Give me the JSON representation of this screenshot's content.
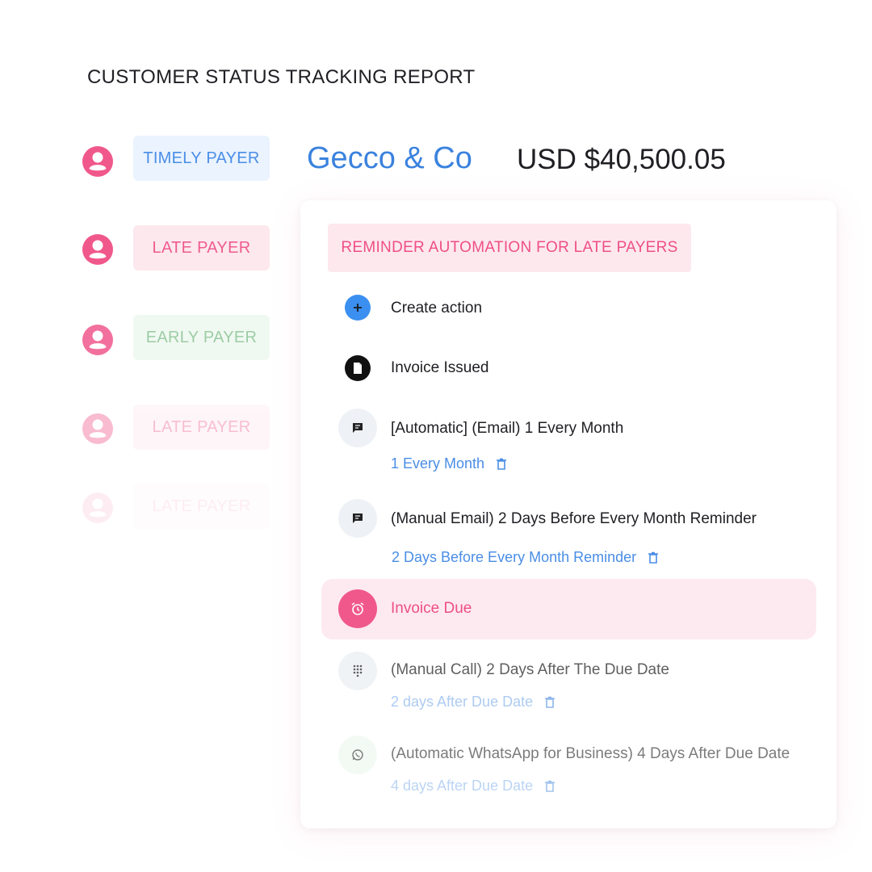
{
  "report_title": "CUSTOMER STATUS TRACKING REPORT",
  "customers": [
    {
      "status": "TIMELY PAYER",
      "variant": "blue",
      "opacity": 1
    },
    {
      "status": "LATE PAYER",
      "variant": "pink",
      "opacity": 1
    },
    {
      "status": "EARLY PAYER",
      "variant": "green",
      "opacity": 1
    },
    {
      "status": "LATE PAYER",
      "variant": "pink",
      "opacity": 0.45
    },
    {
      "status": "LATE PAYER",
      "variant": "pink",
      "opacity": 0.12
    }
  ],
  "company_name": "Gecco & Co",
  "amount": "USD $40,500.05",
  "automation": {
    "header": "REMINDER AUTOMATION FOR LATE PAYERS",
    "create_action": "Create action",
    "invoice_issued": "Invoice Issued",
    "steps": [
      {
        "title": "[Automatic] (Email) 1 Every Month",
        "sub": "1 Every Month",
        "icon": "chat-icon"
      },
      {
        "title": "(Manual Email) 2 Days Before Every Month Reminder",
        "sub": "2 Days Before Every Month Reminder",
        "icon": "chat-icon"
      }
    ],
    "invoice_due": "Invoice Due",
    "after_due": [
      {
        "title": "(Manual Call) 2 Days After The Due Date",
        "sub": "2 days After Due Date",
        "icon": "dialpad-icon"
      },
      {
        "title": "(Automatic WhatsApp for Business) 4 Days After Due Date",
        "sub": "4 days After Due Date",
        "icon": "whatsapp-icon"
      }
    ]
  },
  "colors": {
    "accent_pink": "#f0588c",
    "accent_blue": "#4a8ee6",
    "accent_green": "#8cc497"
  }
}
